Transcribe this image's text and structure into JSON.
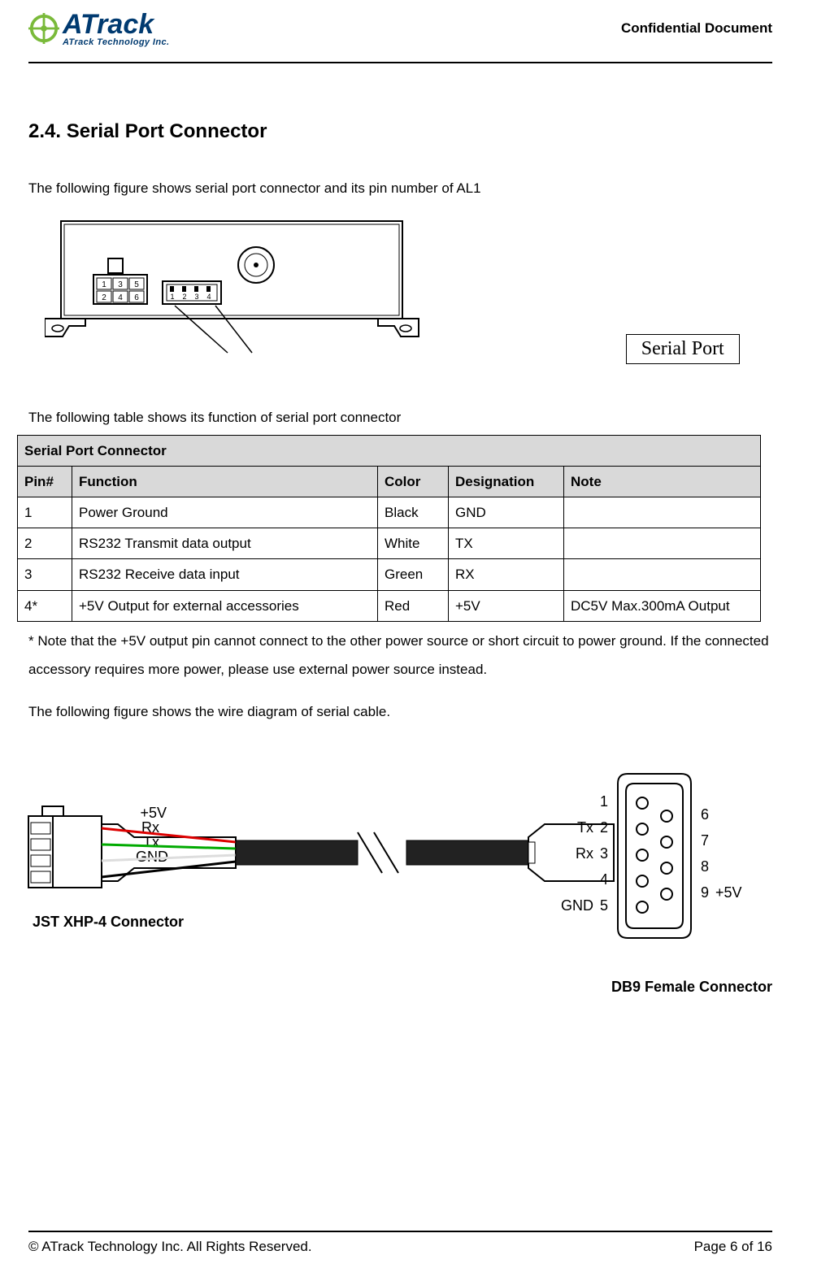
{
  "header": {
    "company_logo_main": "ATrack",
    "company_logo_sub": "ATrack Technology Inc.",
    "confidential": "Confidential  Document"
  },
  "section": {
    "number_title": "2.4.  Serial Port Connector",
    "intro": "The following figure shows serial port connector and its pin number of AL1"
  },
  "figure1": {
    "conn1_pins_top": [
      "1",
      "3",
      "5"
    ],
    "conn1_pins_bottom": [
      "2",
      "4",
      "6"
    ],
    "conn2_pins": [
      "1",
      "2",
      "3",
      "4"
    ],
    "callout": "Serial Port"
  },
  "table": {
    "intro": "The following table shows its function of serial port connector",
    "title": "Serial Port Connector",
    "headers": {
      "pin": "Pin#",
      "function": "Function",
      "color": "Color",
      "designation": "Designation",
      "note": "Note"
    },
    "rows": [
      {
        "pin": "1",
        "function": "Power Ground",
        "color": "Black",
        "designation": "GND",
        "note": ""
      },
      {
        "pin": "2",
        "function": "RS232 Transmit data output",
        "color": "White",
        "designation": "TX",
        "note": ""
      },
      {
        "pin": "3",
        "function": "RS232 Receive data input",
        "color": "Green",
        "designation": "RX",
        "note": ""
      },
      {
        "pin": "4*",
        "function": "+5V Output for external accessories",
        "color": "Red",
        "designation": "+5V",
        "note": "DC5V Max.300mA Output"
      }
    ],
    "footnote": " * Note that the +5V output pin cannot connect to the other power source or short circuit to power ground. If the connected accessory requires more power, please use external power source instead."
  },
  "figure2": {
    "intro": "The following figure shows the wire diagram of serial cable.",
    "jst_label": "JST XHP-4 Connector",
    "db9_label": "DB9 Female Connector",
    "jst_signals": [
      "+5V",
      "Rx",
      "Tx",
      "GND"
    ],
    "db9_left_pins": [
      "1",
      "2",
      "3",
      "4",
      "5"
    ],
    "db9_right_pins": [
      "6",
      "7",
      "8",
      "9"
    ],
    "db9_left_labels": {
      "2": "Tx",
      "3": "Rx",
      "5": "GND"
    },
    "db9_right_labels": {
      "9": "+5V"
    }
  },
  "footer": {
    "copyright": "© ATrack Technology Inc. All Rights Reserved.",
    "page": "Page 6 of 16"
  }
}
